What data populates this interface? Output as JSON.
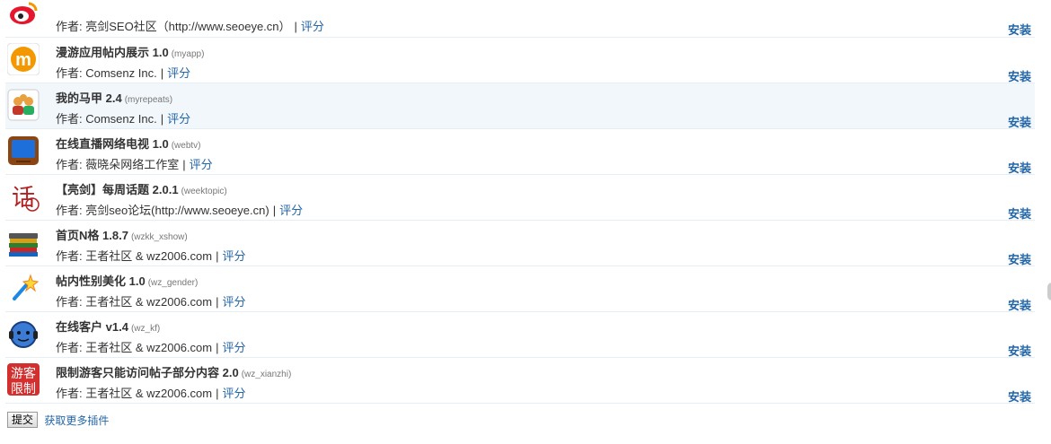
{
  "plugins": [
    {
      "title": "",
      "version": "",
      "id": "",
      "author": "作者: 亮剑SEO社区（http://www.seoeye.cn）",
      "rate": "评分",
      "install": "安装",
      "icon": "weibo-icon"
    },
    {
      "title": "漫游应用帖内展示",
      "version": "1.0",
      "id": "(myapp)",
      "author": "作者: Comsenz Inc.",
      "rate": "评分",
      "install": "安装",
      "icon": "manyou-icon"
    },
    {
      "title": "我的马甲",
      "version": "2.4",
      "id": "(myrepeats)",
      "author": "作者: Comsenz Inc.",
      "rate": "评分",
      "install": "安装",
      "icon": "users-icon"
    },
    {
      "title": "在线直播网络电视",
      "version": "1.0",
      "id": "(webtv)",
      "author": "作者: 薇晓朵网络工作室",
      "rate": "评分",
      "install": "安装",
      "icon": "tv-icon"
    },
    {
      "title": "【亮剑】每周话题",
      "version": "2.0.1",
      "id": "(weektopic)",
      "author": "作者: 亮剑seo论坛(http://www.seoeye.cn)",
      "rate": "评分",
      "install": "安装",
      "icon": "topic-icon"
    },
    {
      "title": "首页N格",
      "version": "1.8.7",
      "id": "(wzkk_xshow)",
      "author": "作者: 王者社区 & wz2006.com",
      "rate": "评分",
      "install": "安装",
      "icon": "books-icon"
    },
    {
      "title": "帖内性别美化",
      "version": "1.0",
      "id": "(wz_gender)",
      "author": "作者: 王者社区 & wz2006.com",
      "rate": "评分",
      "install": "安装",
      "icon": "wand-icon"
    },
    {
      "title": "在线客户",
      "version": "v1.4",
      "id": "(wz_kf)",
      "author": "作者: 王者社区 & wz2006.com",
      "rate": "评分",
      "install": "安装",
      "icon": "headset-icon"
    },
    {
      "title": "限制游客只能访问帖子部分内容",
      "version": "2.0",
      "id": "(wz_xianzhi)",
      "author": "作者: 王者社区 & wz2006.com",
      "rate": "评分",
      "install": "安装",
      "icon": "restrict-icon",
      "icon_text": [
        "游客",
        "限制"
      ]
    }
  ],
  "footer": {
    "submit_label": "提交",
    "more_label": "获取更多插件"
  }
}
